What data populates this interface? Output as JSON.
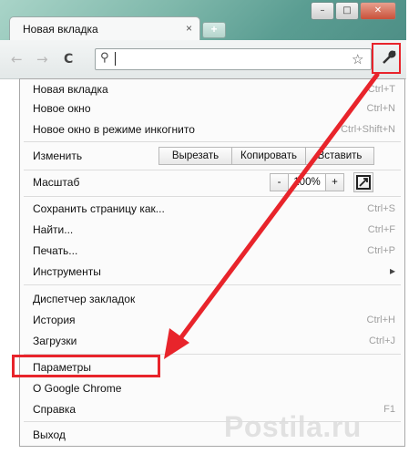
{
  "tab": {
    "title": "Новая вкладка",
    "close": "×",
    "new_tab": "+"
  },
  "window_controls": {
    "minimize": "–",
    "maximize": "□",
    "close": "✕"
  },
  "toolbar": {
    "back": "←",
    "forward": "→",
    "reload": "C",
    "search_glyph": "⚲",
    "star": "☆",
    "wrench": "🔧"
  },
  "menu": {
    "new_tab": {
      "label": "Новая вкладка",
      "shortcut": "Ctrl+T"
    },
    "new_window": {
      "label": "Новое окно",
      "shortcut": "Ctrl+N"
    },
    "incognito": {
      "label": "Новое окно в режиме инкогнито",
      "shortcut": "Ctrl+Shift+N"
    },
    "edit": {
      "label": "Изменить",
      "cut": "Вырезать",
      "copy": "Копировать",
      "paste": "Вставить"
    },
    "zoom": {
      "label": "Масштаб",
      "minus": "-",
      "value": "100%",
      "plus": "+"
    },
    "save_page": {
      "label": "Сохранить страницу как...",
      "shortcut": "Ctrl+S"
    },
    "find": {
      "label": "Найти...",
      "shortcut": "Ctrl+F"
    },
    "print": {
      "label": "Печать...",
      "shortcut": "Ctrl+P"
    },
    "tools": {
      "label": "Инструменты",
      "arrow": "▸"
    },
    "bookmarks_manager": {
      "label": "Диспетчер закладок"
    },
    "history": {
      "label": "История",
      "shortcut": "Ctrl+H"
    },
    "downloads": {
      "label": "Загрузки",
      "shortcut": "Ctrl+J"
    },
    "settings": {
      "label": "Параметры"
    },
    "about": {
      "label": "О Google Chrome"
    },
    "help": {
      "label": "Справка",
      "shortcut": "F1"
    },
    "exit": {
      "label": "Выход"
    }
  },
  "watermark": "Postila.ru",
  "colors": {
    "highlight": "#e8242b",
    "title_gradient": "#5a9d92"
  }
}
